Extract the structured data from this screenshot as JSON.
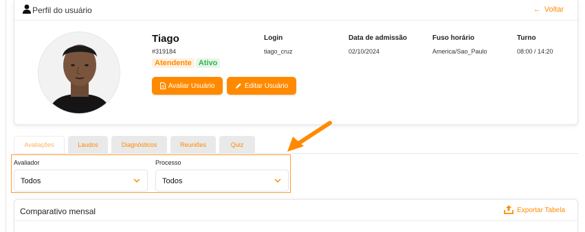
{
  "header": {
    "title": "Perfil do usuário",
    "back_label": "Voltar"
  },
  "user": {
    "name": "Tiago",
    "id": "#319184",
    "role": "Atendente",
    "status": "Ativo",
    "login_label": "Login",
    "login": "tiago_cruz",
    "admission_label": "Data de admissão",
    "admission": "02/10/2024",
    "timezone_label": "Fuso horário",
    "timezone": "America/Sao_Paulo",
    "shift_label": "Turno",
    "shift": "08:00 / 14:20"
  },
  "actions": {
    "evaluate": "Avaliar Usuário",
    "edit": "Editar Usuário"
  },
  "tabs": [
    {
      "label": "Avaliações",
      "active": true
    },
    {
      "label": "Laudos"
    },
    {
      "label": "Diagnósticos"
    },
    {
      "label": "Reuniões"
    },
    {
      "label": "Quiz"
    }
  ],
  "filters": {
    "evaluator_label": "Avaliador",
    "evaluator_value": "Todos",
    "process_label": "Processo",
    "process_value": "Todos"
  },
  "compare": {
    "title": "Comparativo mensal",
    "export_label": "Exportar Tabela"
  },
  "colors": {
    "accent": "#ff8a00",
    "success": "#35b34a"
  },
  "icons": [
    "user-icon",
    "arrow-left-icon",
    "document-icon",
    "pencil-icon",
    "chevron-down-icon",
    "upload-icon",
    "annotation-arrow"
  ]
}
